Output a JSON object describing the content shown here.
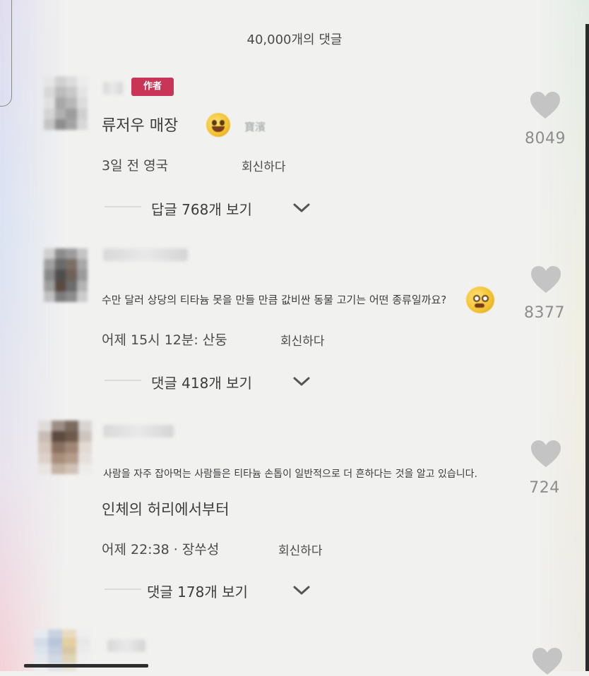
{
  "header": {
    "title": "40,000개의 댓글"
  },
  "comments": [
    {
      "badge": "作者",
      "title": "류저우 매장",
      "tag": "寶濱",
      "meta": "3일 전 영국",
      "reply": "회신하다",
      "view_replies": "답글 768개 보기",
      "likes": "8049"
    },
    {
      "body": "수만 달러 상당의 티타늄 못을 만들 만큼 값비싼 동물 고기는 어떤 종류일까요?",
      "meta": "어제 15시 12분: 산둥",
      "reply": "회신하다",
      "view_replies": "댓글 418개 보기",
      "likes": "8377"
    },
    {
      "body": "사람을 자주 잡아먹는 사람들은 티타늄 손톱이 일반적으로 더 흔하다는 것을 알고 있습니다.",
      "title": "인체의 허리에서부터",
      "meta": "어제 22:38 · 장쑤성",
      "reply": "회신하다",
      "view_replies": "댓글 178개 보기",
      "likes": "724"
    }
  ],
  "icons": {
    "like": "heart-icon",
    "expand": "chevron-down-icon",
    "emoji": "laughing-emoji-icon"
  },
  "colors": {
    "badge": "#c93556",
    "heart": "#c4c4c4",
    "text": "#3c3c3c",
    "count": "#8d8d8d"
  }
}
